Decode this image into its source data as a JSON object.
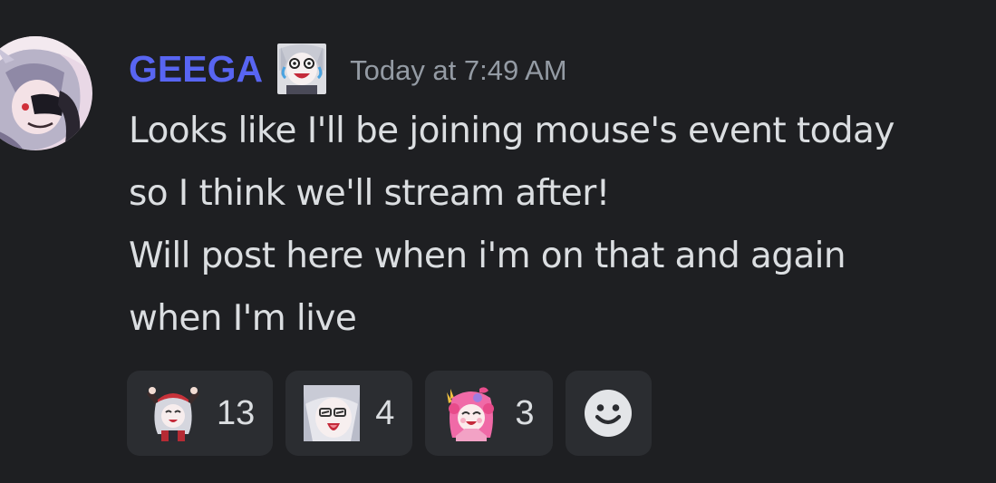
{
  "message": {
    "author": {
      "name": "GEEGA",
      "name_color": "#5865f2",
      "avatar_icon": "anime-avatar-icon",
      "badge_icon": "laughing-emoji-badge-icon"
    },
    "timestamp": "Today at 7:49 AM",
    "lines": [
      "Looks like I'll be joining mouse's event today",
      "so I think we'll stream after!",
      "Will post here when i'm on that and again",
      "when I'm live"
    ],
    "reactions": [
      {
        "emoji_icon": "cheering-girl-emoji-icon",
        "count": "13"
      },
      {
        "emoji_icon": "shouting-girl-emoji-icon",
        "count": "4"
      },
      {
        "emoji_icon": "pink-hair-girl-emoji-icon",
        "count": "3"
      }
    ],
    "add_reaction_icon": "smiley-face-icon"
  },
  "colors": {
    "background": "#1e1f22",
    "text": "#dbdee1",
    "muted": "#949ba4",
    "reaction_bg": "#2b2d31"
  }
}
